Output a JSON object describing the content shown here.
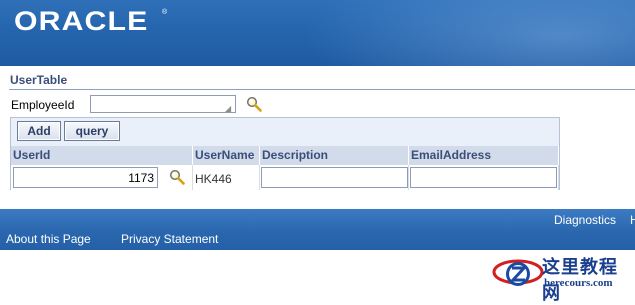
{
  "header": {
    "logo_text": "ORACLE",
    "trademark": "®",
    "colors": {
      "band": "#2565ad"
    }
  },
  "region": {
    "title": "UserTable"
  },
  "employee": {
    "label": "EmployeeId",
    "value": "",
    "lov_icon": "search-icon"
  },
  "table": {
    "buttons": {
      "add": "Add",
      "query": "query"
    },
    "columns": [
      "UserId",
      "UserName",
      "Description",
      "EmailAddress"
    ],
    "rows": [
      {
        "user_id": "1173",
        "user_name": "HK446",
        "description": "",
        "email": ""
      }
    ]
  },
  "footer": {
    "diagnostics": "Diagnostics",
    "trailing": "H",
    "about": "About this Page",
    "privacy": "Privacy Statement"
  },
  "watermark": {
    "cn": "这里教程网",
    "url": "herecours.com"
  }
}
